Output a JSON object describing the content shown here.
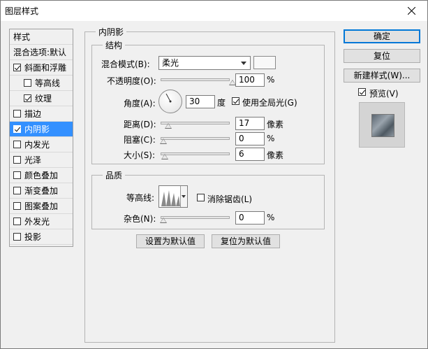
{
  "window": {
    "title": "图层样式",
    "close_icon": "close-icon"
  },
  "left_list": {
    "header": "样式",
    "blend_options": "混合选项:默认",
    "items": [
      {
        "label": "斜面和浮雕",
        "checked": true,
        "indent": false,
        "selected": false
      },
      {
        "label": "等高线",
        "checked": false,
        "indent": true,
        "selected": false
      },
      {
        "label": "纹理",
        "checked": true,
        "indent": true,
        "selected": false
      },
      {
        "label": "描边",
        "checked": false,
        "indent": false,
        "selected": false
      },
      {
        "label": "内阴影",
        "checked": true,
        "indent": false,
        "selected": true
      },
      {
        "label": "内发光",
        "checked": false,
        "indent": false,
        "selected": false
      },
      {
        "label": "光泽",
        "checked": false,
        "indent": false,
        "selected": false
      },
      {
        "label": "颜色叠加",
        "checked": false,
        "indent": false,
        "selected": false
      },
      {
        "label": "渐变叠加",
        "checked": false,
        "indent": false,
        "selected": false
      },
      {
        "label": "图案叠加",
        "checked": false,
        "indent": false,
        "selected": false
      },
      {
        "label": "外发光",
        "checked": false,
        "indent": false,
        "selected": false
      },
      {
        "label": "投影",
        "checked": false,
        "indent": false,
        "selected": false
      }
    ]
  },
  "panel": {
    "title": "内阴影",
    "structure": {
      "title": "结构",
      "blend_mode_label": "混合模式(B):",
      "blend_mode_value": "柔光",
      "opacity_label": "不透明度(O):",
      "opacity_value": "100",
      "opacity_level": 1.0,
      "percent": "%",
      "angle_label": "角度(A):",
      "angle_value": "30",
      "angle_unit": "度",
      "global_light_label": "使用全局光(G)",
      "global_light_checked": true,
      "distance_label": "距离(D):",
      "distance_value": "17",
      "distance_level": 0.068,
      "pixel_unit": "像素",
      "choke_label": "阻塞(C):",
      "choke_value": "0",
      "choke_level": 0.0,
      "size_label": "大小(S):",
      "size_value": "6",
      "size_level": 0.024
    },
    "quality": {
      "title": "品质",
      "contour_label": "等高线:",
      "anti_alias_label": "消除锯齿(L)",
      "anti_alias_checked": false,
      "noise_label": "杂色(N):",
      "noise_value": "0",
      "noise_level": 0.0,
      "percent": "%"
    },
    "set_default_label": "设置为默认值",
    "reset_default_label": "复位为默认值"
  },
  "right": {
    "ok_label": "确定",
    "reset_label": "复位",
    "new_style_label": "新建样式(W)...",
    "preview_label": "预览(V)",
    "preview_checked": true
  }
}
